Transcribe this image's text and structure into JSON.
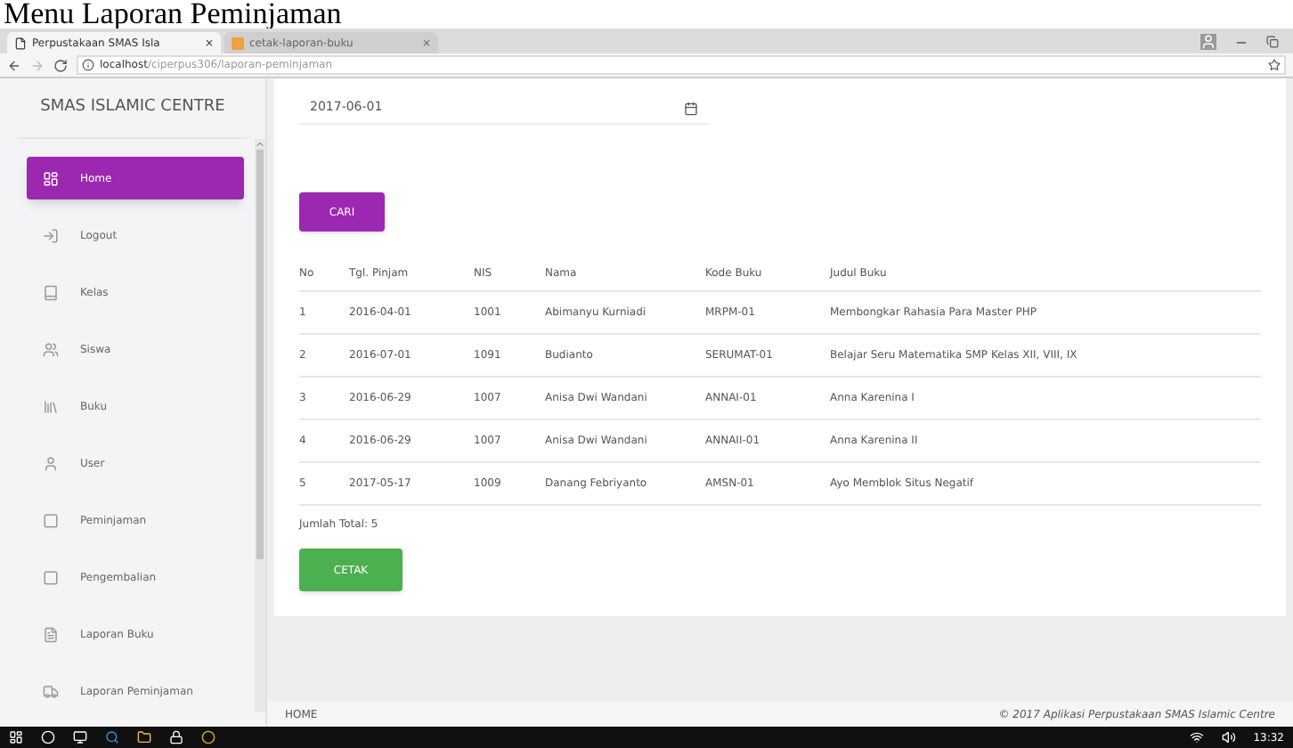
{
  "caption": "Menu Laporan Peminjaman",
  "browser": {
    "tabs": [
      {
        "label": "Perpustakaan SMAS Isla",
        "close": "×",
        "selected": true
      },
      {
        "label": "cetak-laporan-buku",
        "close": "×",
        "selected": false
      }
    ],
    "url_host": "localhost",
    "url_path": "/ciperpus306/laporan-peminjaman"
  },
  "sidebar": {
    "title": "SMAS ISLAMIC CENTRE",
    "items": [
      {
        "label": "Home",
        "selected": true
      },
      {
        "label": "Logout",
        "selected": false
      },
      {
        "label": "Kelas",
        "selected": false
      },
      {
        "label": "Siswa",
        "selected": false
      },
      {
        "label": "Buku",
        "selected": false
      },
      {
        "label": "User",
        "selected": false
      },
      {
        "label": "Peminjaman",
        "selected": false
      },
      {
        "label": "Pengembalian",
        "selected": false
      },
      {
        "label": "Laporan Buku",
        "selected": false
      },
      {
        "label": "Laporan Peminjaman",
        "selected": false
      }
    ]
  },
  "date_field": {
    "value": "2017-06-01"
  },
  "search_button": "CARI",
  "table": {
    "columns": [
      "No",
      "Tgl. Pinjam",
      "NIS",
      "Nama",
      "Kode Buku",
      "Judul Buku"
    ],
    "rows": [
      [
        "1",
        "2016-04-01",
        "1001",
        "Abimanyu Kurniadi",
        "MRPM-01",
        "Membongkar Rahasia Para Master PHP"
      ],
      [
        "2",
        "2016-07-01",
        "1091",
        "Budianto",
        "SERUMAT-01",
        "Belajar Seru Matematika SMP Kelas XII, VIII, IX"
      ],
      [
        "3",
        "2016-06-29",
        "1007",
        "Anisa Dwi Wandani",
        "ANNAI-01",
        "Anna Karenina I"
      ],
      [
        "4",
        "2016-06-29",
        "1007",
        "Anisa Dwi Wandani",
        "ANNAII-01",
        "Anna Karenina II"
      ],
      [
        "5",
        "2017-05-17",
        "1009",
        "Danang Febriyanto",
        "AMSN-01",
        "Ayo Memblok Situs Negatif"
      ]
    ]
  },
  "total": "Jumlah Total: 5",
  "print_button": "CETAK",
  "footer": {
    "left": "HOME",
    "right": "© 2017 Aplikasi Perpustakaan SMAS Islamic Centre"
  },
  "taskbar": {
    "time": "13:32"
  }
}
